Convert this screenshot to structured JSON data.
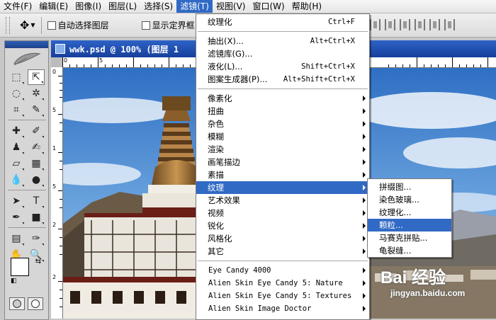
{
  "menubar": {
    "items": [
      "文件(F)",
      "编辑(E)",
      "图像(I)",
      "图层(L)",
      "选择(S)",
      "滤镜(T)",
      "视图(V)",
      "窗口(W)",
      "帮助(H)"
    ]
  },
  "options": {
    "auto_select": "自动选择图层",
    "show_bounds": "显示定界框"
  },
  "document": {
    "title": "wwk.psd @ 100% (图层 1"
  },
  "ruler": {
    "top_ticks": [
      "0",
      "5"
    ],
    "left_ticks": [
      "0",
      "5",
      "1",
      "5",
      "2",
      "2"
    ]
  },
  "filter_menu": {
    "items": [
      {
        "label": "纹理化",
        "shortcut": "Ctrl+F"
      },
      {
        "label": "抽出(X)...",
        "shortcut": "Alt+Ctrl+X"
      },
      {
        "label": "滤镜库(G)..."
      },
      {
        "label": "液化(L)...",
        "shortcut": "Shift+Ctrl+X"
      },
      {
        "label": "图案生成器(P)...",
        "shortcut": "Alt+Shift+Ctrl+X"
      },
      {
        "label": "像素化"
      },
      {
        "label": "扭曲"
      },
      {
        "label": "杂色"
      },
      {
        "label": "模糊"
      },
      {
        "label": "渲染"
      },
      {
        "label": "画笔描边"
      },
      {
        "label": "素描"
      },
      {
        "label": "纹理"
      },
      {
        "label": "艺术效果"
      },
      {
        "label": "视频"
      },
      {
        "label": "锐化"
      },
      {
        "label": "风格化"
      },
      {
        "label": "其它"
      },
      {
        "label": "Eye Candy 4000"
      },
      {
        "label": "Alien Skin Eye Candy 5: Nature"
      },
      {
        "label": "Alien Skin Eye Candy 5: Textures"
      },
      {
        "label": "Alien Skin Image Doctor"
      }
    ]
  },
  "texture_submenu": {
    "items": [
      "拼缀图...",
      "染色玻璃...",
      "纹理化...",
      "颗粒...",
      "马赛克拼贴...",
      "龟裂缝..."
    ]
  },
  "watermark": {
    "line1": "Bai 经验",
    "line2": "jingyan.baidu.com"
  },
  "colors": {
    "highlight": "#316ac5",
    "title_bar": "#2e63c7"
  }
}
